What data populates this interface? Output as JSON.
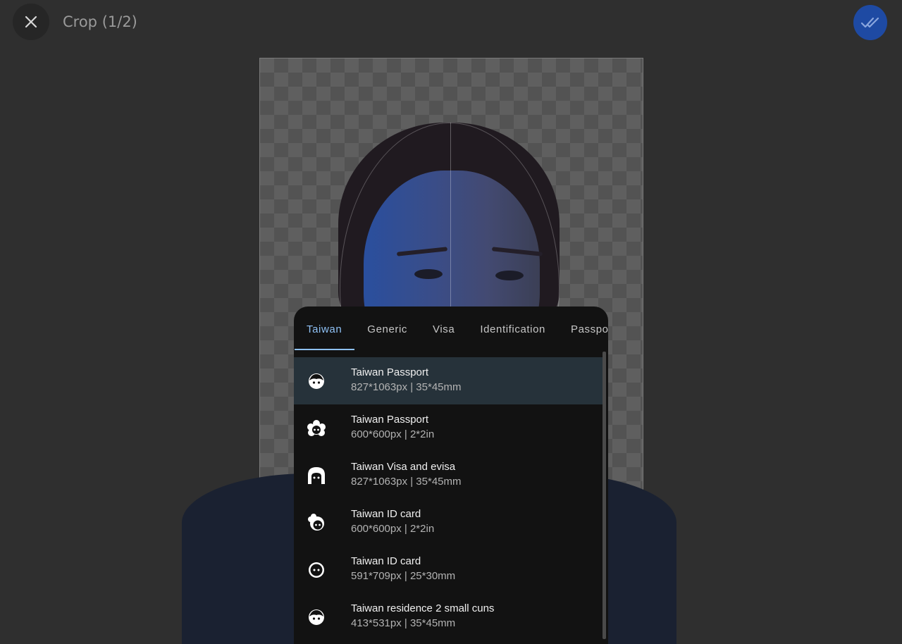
{
  "header": {
    "title": "Crop (1/2)",
    "close_icon": "close-icon",
    "done_icon": "done-all-icon",
    "accent_color": "#1e4aa3"
  },
  "tabs": [
    {
      "label": "Taiwan",
      "active": true
    },
    {
      "label": "Generic",
      "active": false
    },
    {
      "label": "Visa",
      "active": false
    },
    {
      "label": "Identification",
      "active": false
    },
    {
      "label": "Passport",
      "active": false
    }
  ],
  "items": [
    {
      "name": "Taiwan Passport",
      "size": "827*1063px | 35*45mm",
      "icon": "face-icon",
      "selected": true
    },
    {
      "name": "Taiwan Passport",
      "size": "600*600px | 2*2in",
      "icon": "curly-hair-face-icon",
      "selected": false
    },
    {
      "name": "Taiwan Visa and evisa",
      "size": "827*1063px | 35*45mm",
      "icon": "long-hair-face-icon",
      "selected": false
    },
    {
      "name": "Taiwan ID card",
      "size": "600*600px | 2*2in",
      "icon": "side-hair-face-icon",
      "selected": false
    },
    {
      "name": "Taiwan ID card",
      "size": "591*709px | 25*30mm",
      "icon": "plain-face-icon",
      "selected": false
    },
    {
      "name": "Taiwan residence 2 small cuns",
      "size": "413*531px | 35*45mm",
      "icon": "face-icon",
      "selected": false
    }
  ]
}
